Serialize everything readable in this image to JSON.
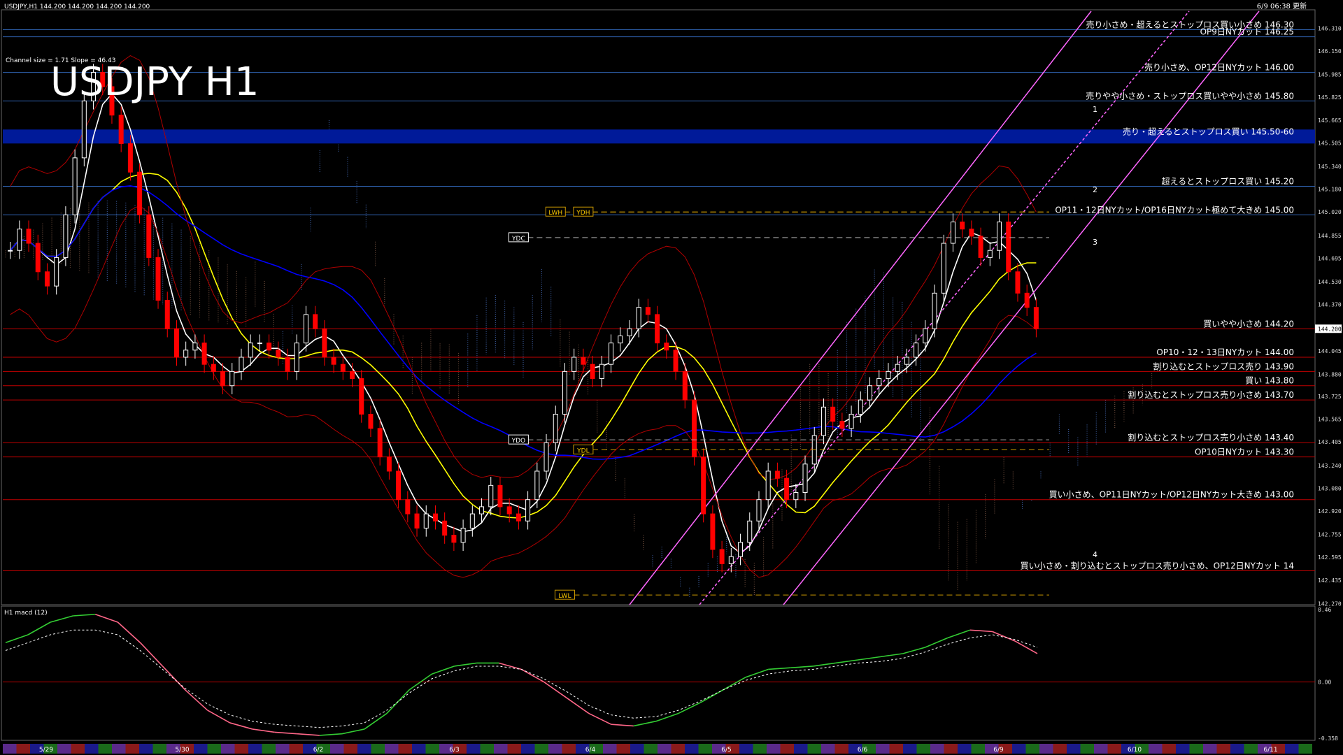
{
  "window": {
    "header_text": "USDJPY,H1  144.200 144.200 144.200 144.200",
    "update_time": "6/9 06:38 更新",
    "channel_info": "Channel size = 1.71 Slope = 46.43",
    "big_title": "USDJPY H1",
    "macd_header": "H1  macd (12)",
    "current_price_tag": "144.200"
  },
  "colors": {
    "bull_candle": "#ffffff",
    "bear_candle": "#ff0000",
    "ma_white": "#ffffff",
    "ma_yellow": "#ffff00",
    "ma_blue": "#0000ff",
    "channel": "#ff66ff",
    "level_blue": "#2f62b0",
    "level_red": "#c00000",
    "macd_up": "#33cc33",
    "macd_down": "#ff6688"
  },
  "chart_data": {
    "type": "line",
    "title": "USDJPY H1",
    "ylim": [
      142.272,
      146.43
    ],
    "y_ticks": [
      "146.310",
      "146.150",
      "145.985",
      "145.825",
      "145.665",
      "145.505",
      "145.340",
      "145.180",
      "145.020",
      "144.855",
      "144.695",
      "144.530",
      "144.370",
      "144.200",
      "144.045",
      "143.880",
      "143.725",
      "143.565",
      "143.405",
      "143.240",
      "143.080",
      "142.920",
      "142.755",
      "142.595",
      "142.435",
      "142.270"
    ],
    "x_ticks": [
      "5/29",
      "5/30",
      "6/2",
      "6/3",
      "6/4",
      "6/5",
      "6/6",
      "6/9",
      "6/10",
      "6/11"
    ],
    "close_series": [
      144.75,
      144.9,
      144.8,
      144.6,
      144.5,
      144.7,
      145.0,
      145.4,
      145.8,
      146.0,
      145.9,
      145.7,
      145.5,
      145.3,
      145.0,
      144.7,
      144.4,
      144.2,
      144.0,
      144.05,
      144.1,
      143.95,
      143.9,
      143.8,
      143.9,
      144.0,
      144.1,
      144.1,
      144.05,
      144.0,
      143.9,
      144.1,
      144.3,
      144.2,
      144.0,
      143.95,
      143.9,
      143.85,
      143.6,
      143.5,
      143.3,
      143.2,
      143.0,
      142.9,
      142.8,
      142.9,
      142.85,
      142.75,
      142.7,
      142.8,
      142.9,
      142.95,
      143.1,
      142.95,
      142.9,
      142.85,
      143.0,
      143.2,
      143.4,
      143.6,
      143.9,
      144.0,
      143.95,
      143.85,
      143.95,
      144.1,
      144.15,
      144.2,
      144.35,
      144.3,
      144.1,
      144.05,
      143.9,
      143.7,
      143.3,
      142.9,
      142.65,
      142.55,
      142.6,
      142.7,
      142.85,
      143.0,
      143.2,
      143.15,
      143.0,
      143.05,
      143.25,
      143.45,
      143.65,
      143.55,
      143.5,
      143.6,
      143.7,
      143.8,
      143.85,
      143.9,
      143.95,
      144.0,
      144.1,
      144.2,
      144.45,
      144.8,
      144.95,
      144.9,
      144.85,
      144.7,
      144.75,
      144.95,
      144.6,
      144.45,
      144.35,
      144.2
    ],
    "levels": [
      {
        "price": 146.3,
        "label": "売り小さめ・超えるとストップロス買い小さめ 146.30",
        "color": "#2f62b0",
        "thick": 1
      },
      {
        "price": 146.25,
        "label": "OP9日NYカット 146.25",
        "color": "#2f62b0",
        "thick": 1
      },
      {
        "price": 146.0,
        "label": "売り小さめ、OP12日NYカット 146.00",
        "color": "#2f62b0",
        "thick": 1
      },
      {
        "price": 145.8,
        "label": "売りやや小さめ・ストップロス買いやや小さめ 145.80",
        "color": "#2f62b0",
        "thick": 1
      },
      {
        "price": 145.55,
        "label": "売り・超えるとストップロス買い 145.50-60",
        "color": "#001a99",
        "thick": 20
      },
      {
        "price": 145.2,
        "label": "超えるとストップロス買い 145.20",
        "color": "#2f62b0",
        "thick": 1
      },
      {
        "price": 145.0,
        "label": "OP11・12日NYカット/OP16日NYカット極めて大きめ 145.00",
        "color": "#2f62b0",
        "thick": 1
      },
      {
        "price": 144.2,
        "label": "買いやや小さめ 144.20",
        "color": "#c00000",
        "thick": 1
      },
      {
        "price": 144.0,
        "label": "OP10・12・13日NYカット 144.00",
        "color": "#c00000",
        "thick": 1
      },
      {
        "price": 143.9,
        "label": "割り込むとストップロス売り 143.90",
        "color": "#c00000",
        "thick": 1
      },
      {
        "price": 143.8,
        "label": "買い 143.80",
        "color": "#c00000",
        "thick": 1
      },
      {
        "price": 143.7,
        "label": "割り込むとストップロス売り小さめ 143.70",
        "color": "#c00000",
        "thick": 1
      },
      {
        "price": 143.4,
        "label": "割り込むとストップロス売り小さめ 143.40",
        "color": "#c00000",
        "thick": 1
      },
      {
        "price": 143.3,
        "label": "OP10日NYカット 143.30",
        "color": "#c00000",
        "thick": 1
      },
      {
        "price": 143.0,
        "label": "買い小さめ、OP11日NYカット/OP12日NYカット大きめ 143.00",
        "color": "#c00000",
        "thick": 1
      },
      {
        "price": 142.5,
        "label": "買い小さめ・割り込むとストップロス売り小さめ、OP12日NYカット 14",
        "color": "#c00000",
        "thick": 1
      }
    ],
    "markers": [
      {
        "label": "LWH",
        "price": 145.02,
        "bar": 59
      },
      {
        "label": "YDH",
        "price": 145.02,
        "bar": 62
      },
      {
        "label": "YDC",
        "price": 144.84,
        "bar": 55
      },
      {
        "label": "YDO",
        "price": 143.42,
        "bar": 55
      },
      {
        "label": "YDL",
        "price": 143.35,
        "bar": 62
      },
      {
        "label": "LWL",
        "price": 142.33,
        "bar": 60
      }
    ],
    "wave_labels": [
      "1",
      "2",
      "3",
      "4"
    ],
    "macd": {
      "ylim": [
        -0.358,
        0.46
      ],
      "y_ticks": [
        "0.46",
        "0.00",
        "-0.358"
      ],
      "line": [
        0.25,
        0.3,
        0.38,
        0.42,
        0.43,
        0.38,
        0.25,
        0.1,
        -0.05,
        -0.18,
        -0.26,
        -0.3,
        -0.32,
        -0.33,
        -0.34,
        -0.33,
        -0.3,
        -0.2,
        -0.05,
        0.05,
        0.1,
        0.12,
        0.12,
        0.08,
        0.0,
        -0.1,
        -0.2,
        -0.27,
        -0.28,
        -0.25,
        -0.2,
        -0.13,
        -0.05,
        0.03,
        0.08,
        0.09,
        0.1,
        0.12,
        0.14,
        0.16,
        0.18,
        0.22,
        0.28,
        0.33,
        0.32,
        0.26,
        0.18
      ],
      "signal": [
        0.2,
        0.25,
        0.3,
        0.33,
        0.33,
        0.3,
        0.2,
        0.08,
        -0.04,
        -0.14,
        -0.21,
        -0.25,
        -0.27,
        -0.28,
        -0.29,
        -0.28,
        -0.26,
        -0.18,
        -0.07,
        0.02,
        0.07,
        0.1,
        0.1,
        0.08,
        0.02,
        -0.06,
        -0.15,
        -0.21,
        -0.23,
        -0.22,
        -0.18,
        -0.12,
        -0.05,
        0.01,
        0.05,
        0.07,
        0.08,
        0.1,
        0.12,
        0.13,
        0.15,
        0.19,
        0.24,
        0.28,
        0.3,
        0.27,
        0.22
      ]
    }
  }
}
